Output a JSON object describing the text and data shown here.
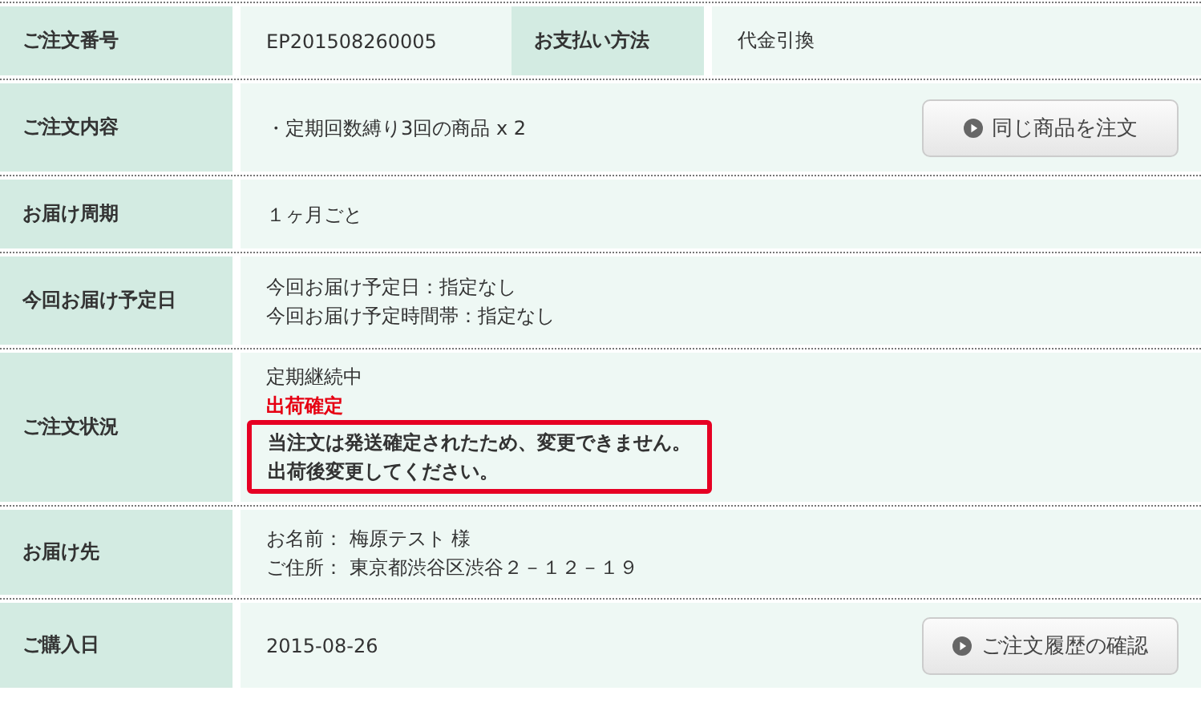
{
  "rows": [
    {
      "label": "ご注文番号",
      "kind": "pair",
      "value": "EP201508260005",
      "label_2": "お支払い方法",
      "value_2": "代金引換"
    },
    {
      "label": "ご注文内容",
      "kind": "lines",
      "lines": [
        {
          "kind": "text",
          "text": "・定期回数縛り3回の商品 x 2"
        }
      ],
      "button": "同じ商品を注文"
    },
    {
      "label": "お届け周期",
      "kind": "lines",
      "lines": [
        {
          "kind": "text",
          "text": "１ヶ月ごと"
        }
      ]
    },
    {
      "label": "今回お届け予定日",
      "kind": "lines",
      "lines": [
        {
          "kind": "text",
          "text": "今回お届け予定日：指定なし"
        },
        {
          "kind": "text",
          "text": "今回お届け予定時間帯：指定なし"
        }
      ]
    },
    {
      "label": "ご注文状況",
      "kind": "lines",
      "lines": [
        {
          "kind": "text",
          "text": "定期継続中"
        },
        {
          "kind": "alert",
          "text": "出荷確定"
        }
      ],
      "notice": [
        "当注文は発送確定されたため、変更できません。",
        "出荷後変更してください。"
      ]
    },
    {
      "label": "お届け先",
      "kind": "lines",
      "lines": [
        {
          "kind": "text",
          "text": "お名前： 梅原テスト 様"
        },
        {
          "kind": "text",
          "text": "ご住所： 東京都渋谷区渋谷２－１２－１９"
        }
      ]
    },
    {
      "label": "ご購入日",
      "kind": "lines",
      "lines": [
        {
          "kind": "text",
          "text": "2015-08-26"
        }
      ],
      "button": "ご注文履歴の確認"
    }
  ]
}
